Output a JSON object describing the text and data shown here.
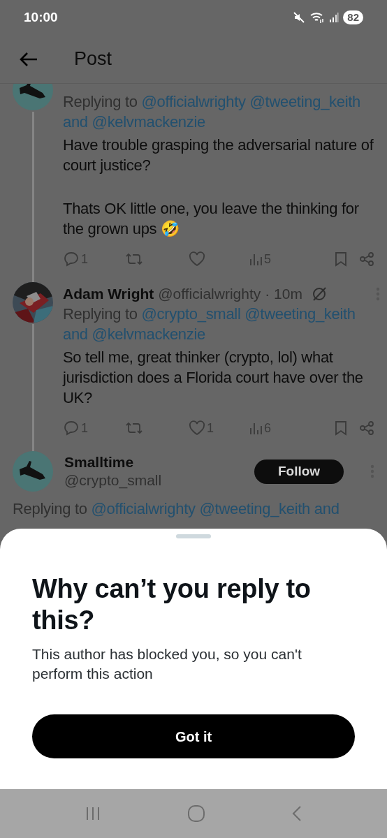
{
  "status_bar": {
    "time": "10:00",
    "battery": "82"
  },
  "header": {
    "title": "Post"
  },
  "tweets": [
    {
      "kind": "parent",
      "replying_prefix": "Replying to",
      "mentions": "@officialwrighty @tweeting_keith and @kelvmackenzie",
      "paragraphs": [
        "Have trouble grasping the adversarial nature of court justice?",
        "Thats OK little one, you leave the thinking for the grown ups 🤣"
      ],
      "actions": [
        {
          "kind": "reply",
          "count": "1"
        },
        {
          "kind": "repost"
        },
        {
          "kind": "like"
        },
        {
          "kind": "views",
          "count": "5"
        },
        {
          "kind": "bookmark"
        },
        {
          "kind": "share"
        }
      ]
    },
    {
      "kind": "parent",
      "name": "Adam Wright",
      "handle": "@officialwrighty",
      "time": "· 10m",
      "replying_prefix": "Replying to",
      "mentions": "@crypto_small @tweeting_keith and @kelvmackenzie",
      "paragraphs": [
        "So tell me, great thinker (crypto, lol) what jurisdiction does a Florida court have over the UK?"
      ],
      "actions": [
        {
          "kind": "reply",
          "count": "1"
        },
        {
          "kind": "repost"
        },
        {
          "kind": "like",
          "count": "1"
        },
        {
          "kind": "views",
          "count": "6"
        },
        {
          "kind": "bookmark"
        },
        {
          "kind": "share"
        }
      ]
    },
    {
      "kind": "focus",
      "name": "Smalltime",
      "handle": "@crypto_small",
      "follow_button": "Follow",
      "replying_prefix": "Replying to",
      "mentions": "@officialwrighty @tweeting_keith and"
    }
  ],
  "sheet": {
    "title": "Why can’t you reply to this?",
    "body": "This author has blocked you, so you can't perform this action",
    "button": "Got it"
  }
}
